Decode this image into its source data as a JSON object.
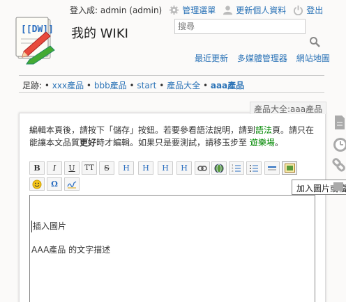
{
  "user": {
    "logged_in_label": "登入成: admin (admin)"
  },
  "top_menu": [
    {
      "label": "管理選單",
      "icon": "gear-icon"
    },
    {
      "label": "更新個人資料",
      "icon": "user-icon"
    },
    {
      "label": "登出",
      "icon": "power-icon"
    }
  ],
  "site": {
    "title": "我的 WIKI"
  },
  "search": {
    "placeholder": "搜尋"
  },
  "sub_nav": [
    "最近更新",
    "多媒體管理器",
    "網站地圖"
  ],
  "breadcrumb": {
    "prefix": "足跡:",
    "items": [
      "xxx產品",
      "bbb產品",
      "start",
      "產品大全",
      "aaa產品"
    ]
  },
  "page_tab": "產品大全:aaa產品",
  "intro": {
    "part1": "編輯本頁後，請按下「儲存」按鈕。若要參看語法說明，請到",
    "syntax_link": "語法",
    "part2": "頁。請只在能讓本文品質",
    "bold": "更好",
    "part3": "時才編輯。如果只是要測試，請移玉步至",
    "playground_link": "遊樂場",
    "part4": "。"
  },
  "toolbar": {
    "buttons": [
      "B",
      "I",
      "U",
      "TT",
      "S",
      "H",
      "H",
      "H",
      "H",
      "link",
      "globe",
      "ol",
      "ul",
      "hr",
      "image",
      "smiley",
      "Ω",
      "sig"
    ]
  },
  "tooltip": "加入圖片或檔",
  "editor": {
    "lines": [
      "插入圖片",
      "AAA產品 的文字描述"
    ]
  },
  "colors": {
    "link": "#2b73b7",
    "green_link": "#008800",
    "background": "#fbfaf9"
  }
}
